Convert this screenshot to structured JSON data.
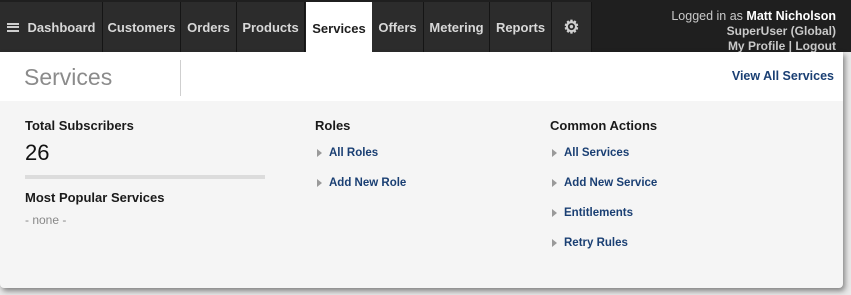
{
  "nav": {
    "tabs": [
      {
        "label": "Dashboard"
      },
      {
        "label": "Customers"
      },
      {
        "label": "Orders"
      },
      {
        "label": "Products"
      },
      {
        "label": "Services",
        "active": true
      },
      {
        "label": "Offers"
      },
      {
        "label": "Metering"
      },
      {
        "label": "Reports"
      }
    ],
    "settings_icon": "gear-icon",
    "menu_icon": "hamburger-menu-icon"
  },
  "user": {
    "prefix": "Logged in as ",
    "name": "Matt Nicholson",
    "role": "SuperUser (Global)",
    "profile_link": "My Profile",
    "separator": "|",
    "logout_link": "Logout"
  },
  "dropdown": {
    "title": "Services",
    "view_all": "View All Services",
    "subscribers": {
      "heading": "Total Subscribers",
      "count": "26"
    },
    "popular": {
      "heading": "Most Popular Services",
      "empty_text": "- none -"
    },
    "roles": {
      "heading": "Roles",
      "links": [
        "All Roles",
        "Add New Role"
      ]
    },
    "actions": {
      "heading": "Common Actions",
      "links": [
        "All Services",
        "Add New Service",
        "Entitlements",
        "Retry Rules"
      ]
    }
  },
  "colors": {
    "nav_bg": "#1f1f1f",
    "tab_bg": "#2c2c2c",
    "link": "#1a3f73",
    "panel_bg": "#f5f5f5"
  }
}
